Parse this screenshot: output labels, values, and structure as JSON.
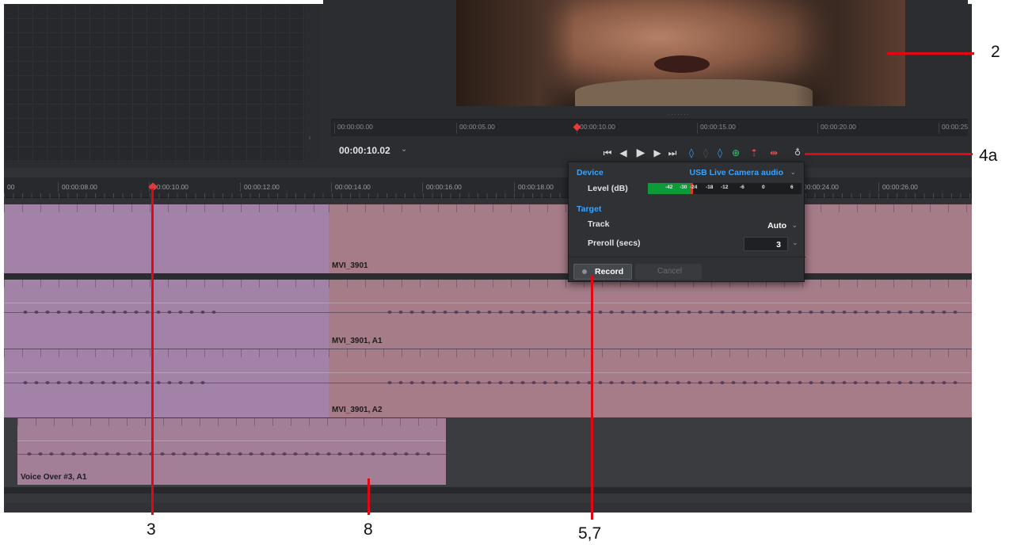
{
  "viewer": {
    "ruler_ticks": [
      "00:00:00.00",
      "00:00:05.00",
      "00:00:10.00",
      "00:00:15.00",
      "00:00:20.00",
      "00:00:25"
    ],
    "timecode": "00:00:10.02",
    "controls": [
      {
        "name": "go-to-start-icon",
        "glyph": "⏮"
      },
      {
        "name": "step-back-icon",
        "glyph": "◀|"
      },
      {
        "name": "play-icon",
        "glyph": "▶"
      },
      {
        "name": "step-forward-icon",
        "glyph": "|▶"
      },
      {
        "name": "go-to-end-icon",
        "glyph": "⏭"
      },
      {
        "name": "mark-in-icon",
        "glyph": "◊"
      },
      {
        "name": "mark-clip-icon",
        "glyph": "◊"
      },
      {
        "name": "mark-out-icon",
        "glyph": "◊"
      },
      {
        "name": "add-marker-icon",
        "glyph": "⊕"
      },
      {
        "name": "lift-icon",
        "glyph": "⇡"
      },
      {
        "name": "extract-icon",
        "glyph": "⇹"
      },
      {
        "name": "microphone-icon",
        "glyph": "🎙"
      }
    ]
  },
  "timeline": {
    "ruler_ticks": [
      "00",
      "00:00:08.00",
      "00:00:10.00",
      "00:00:12.00",
      "00:00:14.00",
      "00:00:16.00",
      "00:00:18.00",
      "00:00:24.00",
      "00:00:26.00"
    ],
    "clips": {
      "video": "MVI_3901",
      "audio1": "MVI_3901, A1",
      "audio2": "MVI_3901, A2",
      "voice_over": "Voice Over #3, A1"
    }
  },
  "record_popup": {
    "device_section": "Device",
    "device_value": "USB Live Camera audio",
    "level_label": "Level (dB)",
    "meter_scale": [
      "-42",
      "-30",
      "-24",
      "-18",
      "-12",
      "-6",
      "0",
      "6"
    ],
    "meter_level_fraction": 0.28,
    "target_section": "Target",
    "track_label": "Track",
    "track_value": "Auto",
    "preroll_label": "Preroll (secs)",
    "preroll_value": "3",
    "record_label": "Record",
    "cancel_label": "Cancel"
  },
  "callouts": {
    "c2": "2",
    "c4a": "4a",
    "c3": "3",
    "c8": "8",
    "c57": "5,7"
  },
  "colors": {
    "accent_blue": "#3aa3ff",
    "playhead_red": "#e23b3b",
    "annotation_red": "#e30613",
    "device_orange": "#ff9b3a"
  }
}
